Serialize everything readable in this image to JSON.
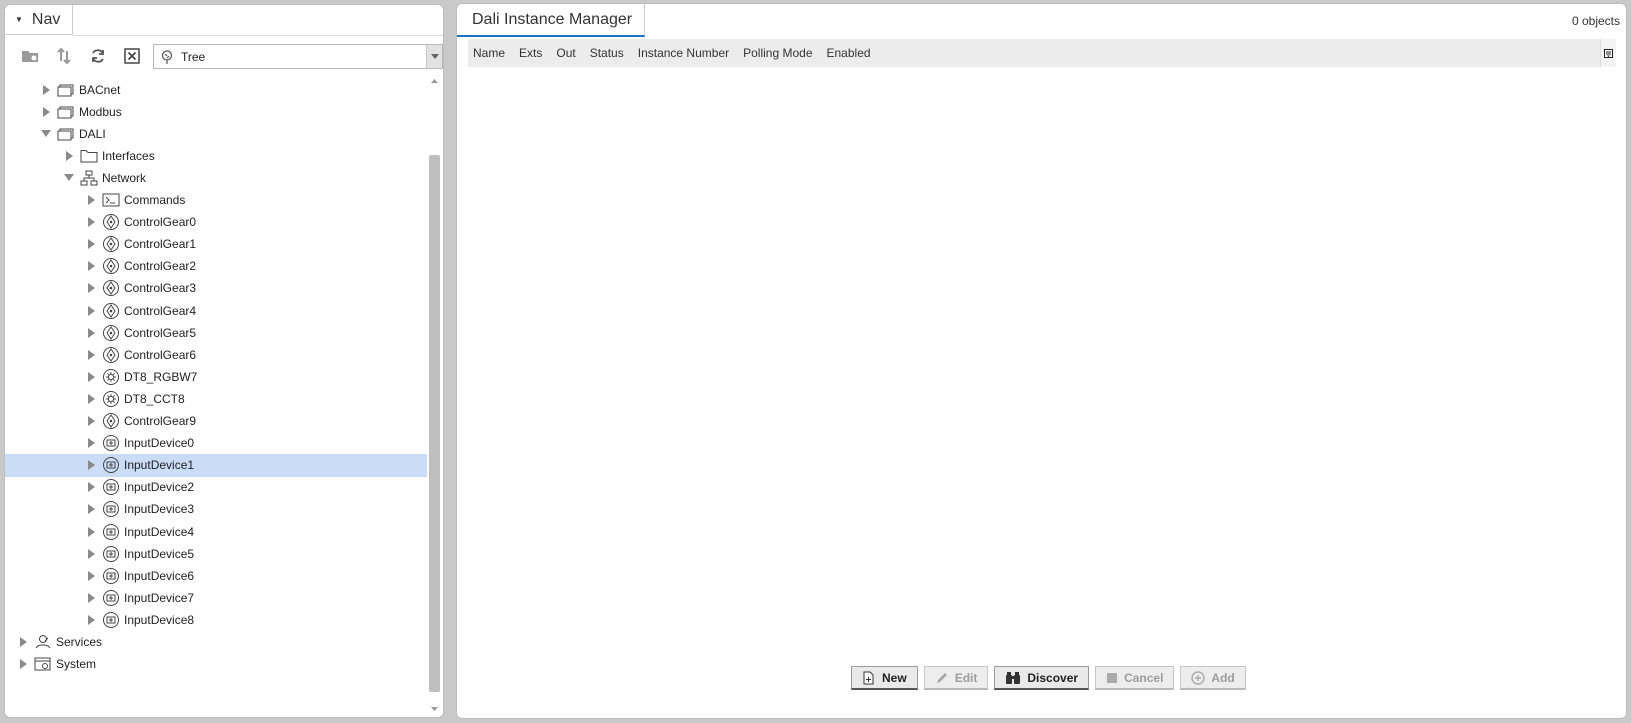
{
  "nav": {
    "title": "Nav",
    "tree_mode": "Tree",
    "toolbar": [
      "new-folder-icon",
      "sort-icon",
      "refresh-icon",
      "close-icon"
    ]
  },
  "tree": [
    {
      "label": "BACnet",
      "depth": 1,
      "expanded": false,
      "icon": "network-folder-icon"
    },
    {
      "label": "Modbus",
      "depth": 1,
      "expanded": false,
      "icon": "network-folder-icon"
    },
    {
      "label": "DALI",
      "depth": 1,
      "expanded": true,
      "icon": "network-folder-icon"
    },
    {
      "label": "Interfaces",
      "depth": 2,
      "expanded": false,
      "icon": "folder-icon"
    },
    {
      "label": "Network",
      "depth": 2,
      "expanded": true,
      "icon": "network-icon"
    },
    {
      "label": "Commands",
      "depth": 3,
      "expanded": false,
      "icon": "commands-icon"
    },
    {
      "label": "ControlGear0",
      "depth": 3,
      "expanded": false,
      "icon": "control-gear-icon"
    },
    {
      "label": "ControlGear1",
      "depth": 3,
      "expanded": false,
      "icon": "control-gear-icon"
    },
    {
      "label": "ControlGear2",
      "depth": 3,
      "expanded": false,
      "icon": "control-gear-icon"
    },
    {
      "label": "ControlGear3",
      "depth": 3,
      "expanded": false,
      "icon": "control-gear-icon"
    },
    {
      "label": "ControlGear4",
      "depth": 3,
      "expanded": false,
      "icon": "control-gear-icon"
    },
    {
      "label": "ControlGear5",
      "depth": 3,
      "expanded": false,
      "icon": "control-gear-icon"
    },
    {
      "label": "ControlGear6",
      "depth": 3,
      "expanded": false,
      "icon": "control-gear-icon"
    },
    {
      "label": "DT8_RGBW7",
      "depth": 3,
      "expanded": false,
      "icon": "color-gear-icon"
    },
    {
      "label": "DT8_CCT8",
      "depth": 3,
      "expanded": false,
      "icon": "color-gear-icon"
    },
    {
      "label": "ControlGear9",
      "depth": 3,
      "expanded": false,
      "icon": "control-gear-icon"
    },
    {
      "label": "InputDevice0",
      "depth": 3,
      "expanded": false,
      "icon": "input-device-icon"
    },
    {
      "label": "InputDevice1",
      "depth": 3,
      "expanded": false,
      "icon": "input-device-icon",
      "selected": true
    },
    {
      "label": "InputDevice2",
      "depth": 3,
      "expanded": false,
      "icon": "input-device-icon"
    },
    {
      "label": "InputDevice3",
      "depth": 3,
      "expanded": false,
      "icon": "input-device-icon"
    },
    {
      "label": "InputDevice4",
      "depth": 3,
      "expanded": false,
      "icon": "input-device-icon"
    },
    {
      "label": "InputDevice5",
      "depth": 3,
      "expanded": false,
      "icon": "input-device-icon"
    },
    {
      "label": "InputDevice6",
      "depth": 3,
      "expanded": false,
      "icon": "input-device-icon"
    },
    {
      "label": "InputDevice7",
      "depth": 3,
      "expanded": false,
      "icon": "input-device-icon"
    },
    {
      "label": "InputDevice8",
      "depth": 3,
      "expanded": false,
      "icon": "input-device-icon"
    },
    {
      "label": "Services",
      "depth": 0,
      "expanded": false,
      "icon": "services-icon"
    },
    {
      "label": "System",
      "depth": 0,
      "expanded": false,
      "icon": "system-icon"
    }
  ],
  "main": {
    "title": "Dali Instance Manager",
    "object_count": "0 objects",
    "columns": [
      "Name",
      "Exts",
      "Out",
      "Status",
      "Instance Number",
      "Polling Mode",
      "Enabled"
    ],
    "buttons": [
      {
        "label": "New",
        "enabled": true,
        "icon": "new-icon"
      },
      {
        "label": "Edit",
        "enabled": false,
        "icon": "edit-icon"
      },
      {
        "label": "Discover",
        "enabled": true,
        "icon": "binoculars-icon"
      },
      {
        "label": "Cancel",
        "enabled": false,
        "icon": "stop-icon"
      },
      {
        "label": "Add",
        "enabled": false,
        "icon": "add-icon"
      }
    ]
  },
  "colors": {
    "selection": "#cbdcf7",
    "tab_underline": "#1e73be",
    "background": "#c9c9c9"
  }
}
